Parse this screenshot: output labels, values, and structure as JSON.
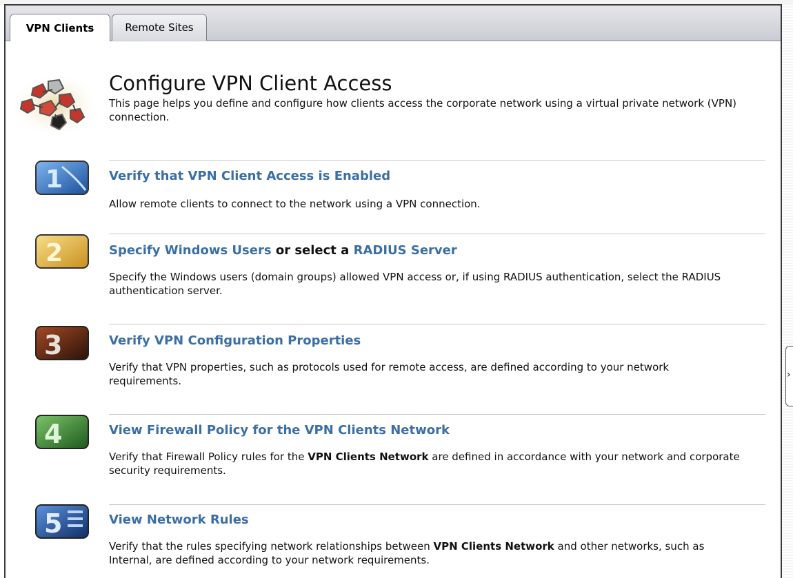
{
  "tabs": [
    {
      "label": "VPN Clients",
      "active": true
    },
    {
      "label": "Remote Sites",
      "active": false
    }
  ],
  "header": {
    "title": "Configure VPN Client Access",
    "description": "This page helps you define and configure how clients access the corporate network using a virtual private network (VPN) connection.",
    "icon": "vpn-network-icon"
  },
  "steps": [
    {
      "number": "1",
      "icon": "step-1-icon",
      "icon_color": "#2f6fc4",
      "title": "Verify that VPN Client Access is Enabled",
      "description": "Allow remote clients to connect to the network using a VPN connection."
    },
    {
      "number": "2",
      "icon": "step-2-icon",
      "icon_color": "#e0b43a",
      "title_link1": "Specify Windows Users",
      "title_mid": " or select a ",
      "title_link2": "RADIUS Server",
      "description": "Specify the Windows users (domain groups) allowed VPN access or, if using RADIUS authentication, select the RADIUS authentication server."
    },
    {
      "number": "3",
      "icon": "step-3-icon",
      "icon_color": "#6b2a14",
      "title": "Verify VPN Configuration Properties",
      "description": "Verify that VPN properties, such as protocols used for remote access, are defined according to your network requirements."
    },
    {
      "number": "4",
      "icon": "step-4-icon",
      "icon_color": "#2c7a2c",
      "title": "View Firewall Policy for the VPN Clients Network",
      "desc_pre": "Verify that Firewall Policy rules for the ",
      "desc_bold": "VPN Clients Network",
      "desc_post": " are defined in accordance with your network and corporate security requirements."
    },
    {
      "number": "5",
      "icon": "step-5-icon",
      "icon_color": "#1f4f9a",
      "title": "View Network Rules",
      "desc_pre": "Verify that the rules specifying network relationships between ",
      "desc_bold": "VPN Clients Network",
      "desc_post": " and other networks, such as Internal, are defined according to your network requirements."
    }
  ],
  "colors": {
    "link": "#3a6ea5",
    "divider": "#c8c8c8"
  },
  "collapse_handle": {
    "glyph": "›",
    "icon": "chevron-right-icon"
  }
}
